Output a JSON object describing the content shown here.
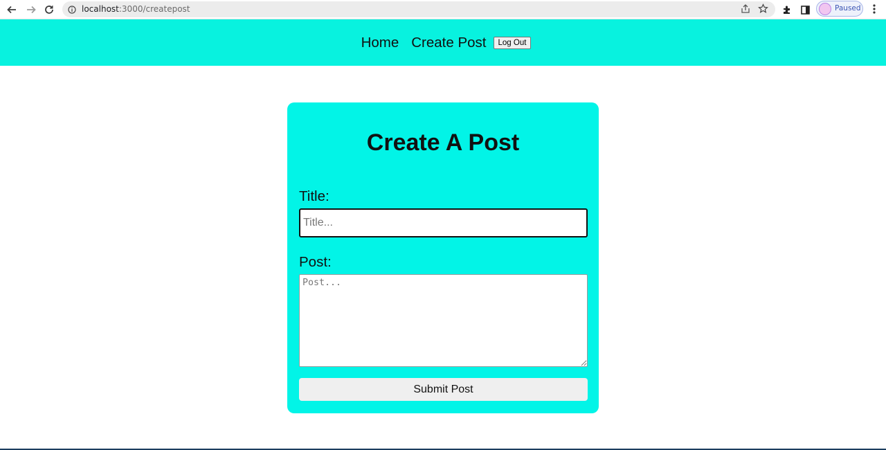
{
  "browser": {
    "url_host": "localhost",
    "url_path": ":3000/createpost",
    "profile_status": "Paused",
    "icons": [
      "back-icon",
      "forward-icon",
      "reload-icon",
      "info-icon",
      "share-icon",
      "star-icon",
      "extensions-icon",
      "sidepanel-icon",
      "menu-icon"
    ]
  },
  "navbar": {
    "links": [
      "Home",
      "Create Post"
    ],
    "logout_label": "Log Out",
    "color": "#08f2df"
  },
  "card": {
    "heading": "Create A Post",
    "title_label": "Title:",
    "title_placeholder": "Title...",
    "title_value": "",
    "post_label": "Post:",
    "post_placeholder": "Post...",
    "post_value": "",
    "submit_label": "Submit Post",
    "color": "#02f4e7"
  }
}
